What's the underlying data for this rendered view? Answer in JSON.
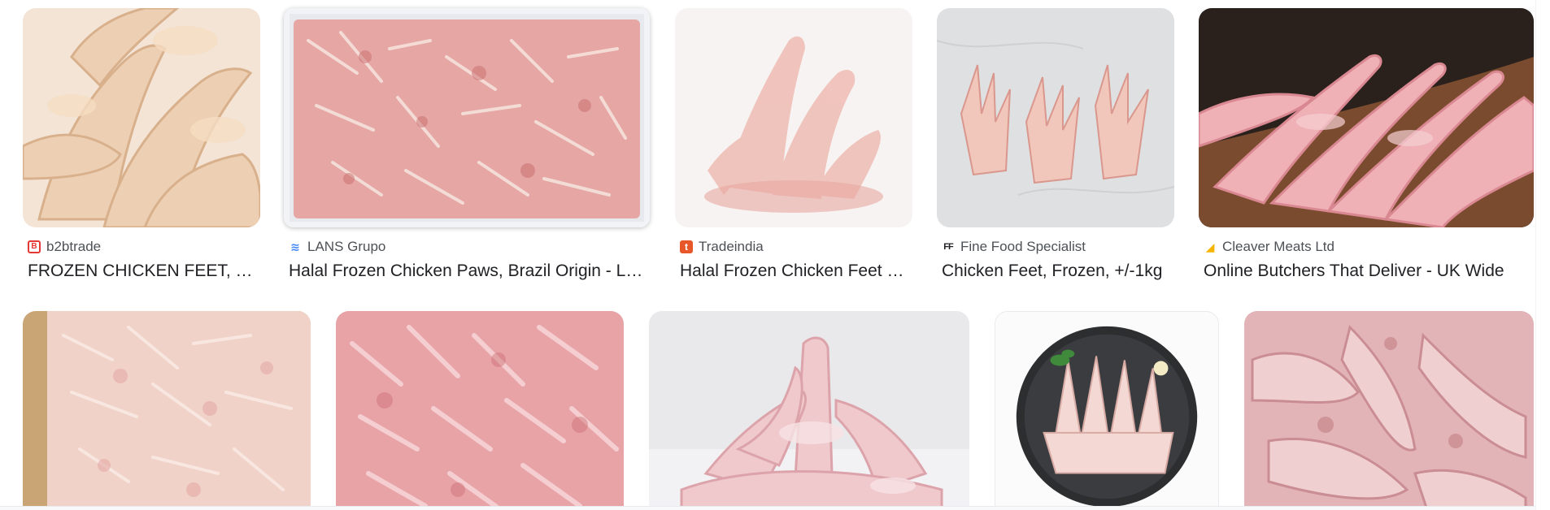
{
  "results": [
    {
      "source": "b2btrade",
      "title": "FROZEN CHICKEN FEET, Buy FROZEN CHICKEN FEET",
      "favicon": "b2btrade-icon",
      "favicon_color": "#e53935"
    },
    {
      "source": "LANS Grupo",
      "title": "Halal Frozen Chicken Paws, Brazil Origin - LANS Grupo",
      "favicon": "lans-grupo-icon",
      "favicon_color": "#4285f4"
    },
    {
      "source": "Tradeindia",
      "title": "Halal Frozen Chicken Feet at Best Price",
      "favicon": "tradeindia-icon",
      "favicon_color": "#e8572a"
    },
    {
      "source": "Fine Food Specialist",
      "title": "Chicken Feet, Frozen, +/-1kg",
      "favicon": "fine-food-specialist-icon",
      "favicon_color": "#202124"
    },
    {
      "source": "Cleaver Meats Ltd",
      "title": "Online Butchers That Deliver - UK Wide",
      "favicon": "cleaver-meats-icon",
      "favicon_color": "#f4b400"
    }
  ],
  "second_row_count_note": "",
  "colors": {
    "text_primary": "#202124",
    "text_secondary": "#4d5156",
    "thumb_pink": "#f2c6c4",
    "thumb_pale": "#f6dcc8",
    "thumb_flesh": "#e99fa0"
  }
}
